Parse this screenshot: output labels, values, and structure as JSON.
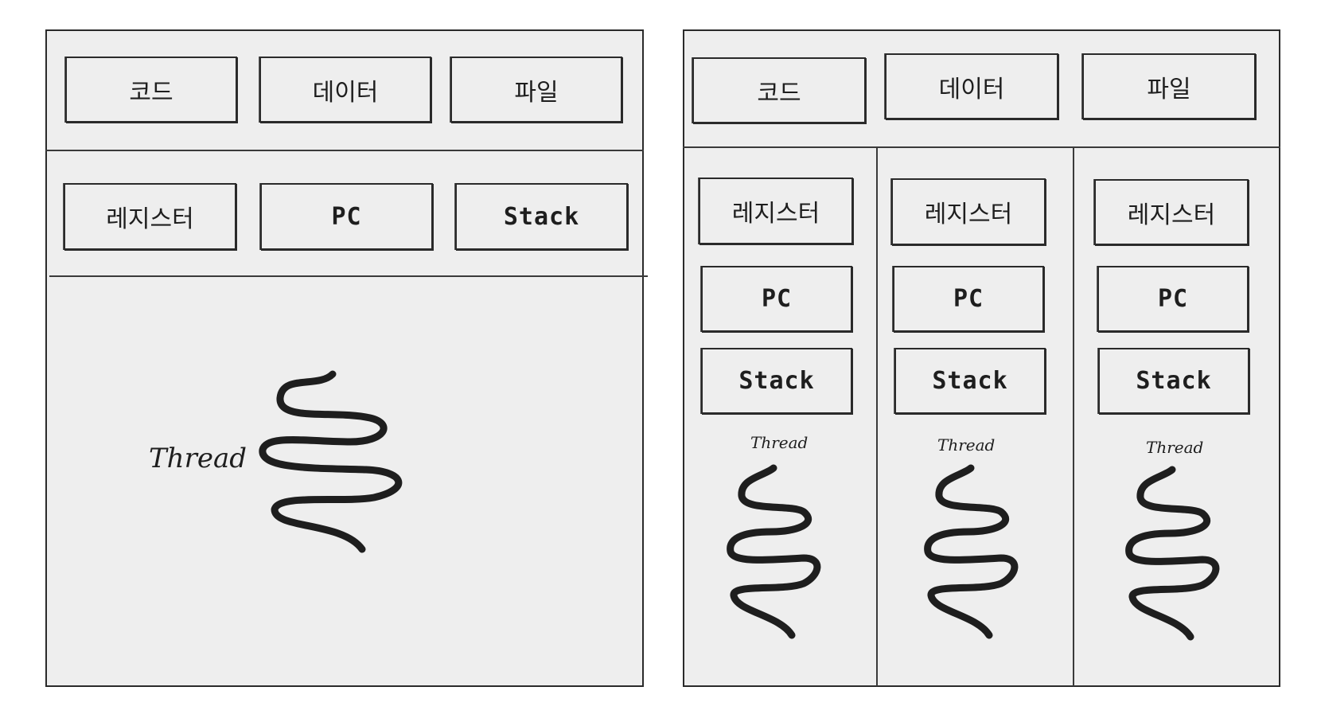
{
  "single_threaded": {
    "shared": [
      "코드",
      "데이터",
      "파일"
    ],
    "thread_state": [
      "레지스터",
      "PC",
      "Stack"
    ],
    "thread_label": "Thread"
  },
  "multi_threaded": {
    "shared": [
      "코드",
      "데이터",
      "파일"
    ],
    "threads": [
      {
        "items": [
          "레지스터",
          "PC",
          "Stack"
        ],
        "label": "Thread"
      },
      {
        "items": [
          "레지스터",
          "PC",
          "Stack"
        ],
        "label": "Thread"
      },
      {
        "items": [
          "레지스터",
          "PC",
          "Stack"
        ],
        "label": "Thread"
      }
    ]
  },
  "colors": {
    "panel": "#eeeeee",
    "stroke": "#1e1e1e"
  }
}
